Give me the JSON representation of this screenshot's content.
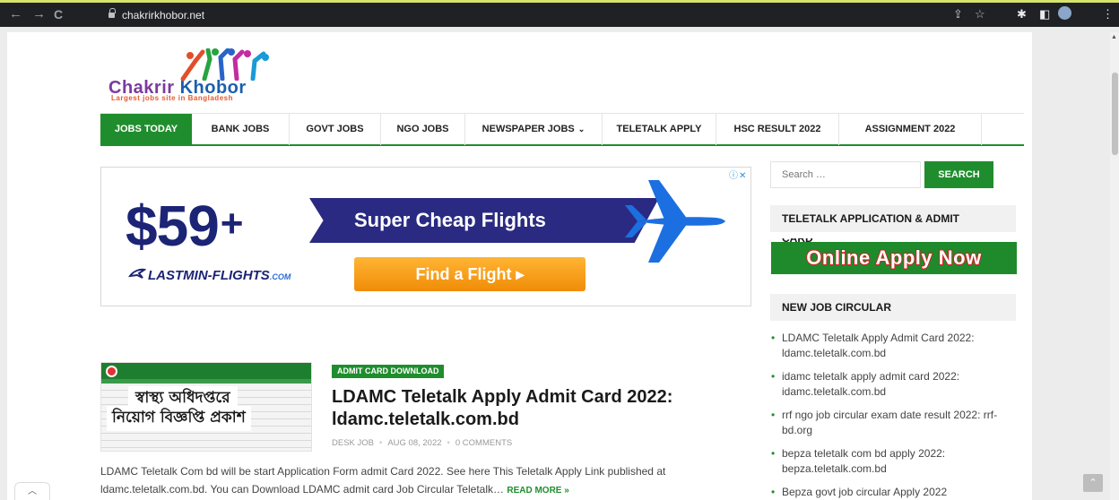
{
  "browser": {
    "url": "chakrirkhobor.net"
  },
  "site": {
    "logo_title_1": "Chakrir",
    "logo_title_2": " Khobor",
    "logo_tagline": "Largest jobs site in Bangladesh"
  },
  "menu": {
    "items": [
      {
        "label": "JOBS TODAY",
        "active": true
      },
      {
        "label": "BANK JOBS"
      },
      {
        "label": "GOVT JOBS"
      },
      {
        "label": "NGO JOBS"
      },
      {
        "label": "NEWSPAPER JOBS"
      },
      {
        "label": "TELETALK APPLY"
      },
      {
        "label": "HSC RESULT 2022"
      },
      {
        "label": "ASSIGNMENT 2022"
      }
    ]
  },
  "ad": {
    "price": "$59",
    "price_plus": "+",
    "headline": "Super Cheap Flights",
    "brand": "LASTMIN-FLIGHTS",
    "brand_suffix": ".COM",
    "cta": "Find a Flight ▸",
    "info": "ⓘ✕"
  },
  "post": {
    "category": "ADMIT CARD DOWNLOAD",
    "title": "LDAMC Teletalk Apply Admit Card 2022: ldamc.teletalk.com.bd",
    "author": "DESK JOB",
    "date": "AUG 08, 2022",
    "comments": "0 COMMENTS",
    "excerpt": "LDAMC Teletalk Com bd will be start Application Form admit Card 2022. See here This Teletalk Apply Link published at ldamc.teletalk.com.bd. You can Download LDAMC admit card Job Circular Teletalk…",
    "read_more": "READ MORE »",
    "thumb_line1": "স্বাস্থ্য অধিদপ্তরে",
    "thumb_line2": "নিয়োগ বিজ্ঞপ্তি প্রকাশ"
  },
  "sidebar": {
    "search_placeholder": "Search …",
    "search_button": "SEARCH",
    "widget1_title": "TELETALK APPLICATION & ADMIT",
    "widget1_title_overflow": "CARD",
    "apply_banner": "Online Apply Now",
    "widget2_title": "NEW JOB CIRCULAR",
    "jobs": [
      "LDAMC Teletalk Apply Admit Card 2022: ldamc.teletalk.com.bd",
      "idamc teletalk apply admit card 2022: idamc.teletalk.com.bd",
      "rrf ngo job circular exam date result 2022: rrf-bd.org",
      "bepza teletalk com bd apply 2022: bepza.teletalk.com.bd",
      "Bepza govt job circular Apply 2022"
    ]
  },
  "colors": {
    "brand_green": "#1f8d2d",
    "ad_navy": "#1c2475",
    "ad_orange": "#f6a01a"
  }
}
